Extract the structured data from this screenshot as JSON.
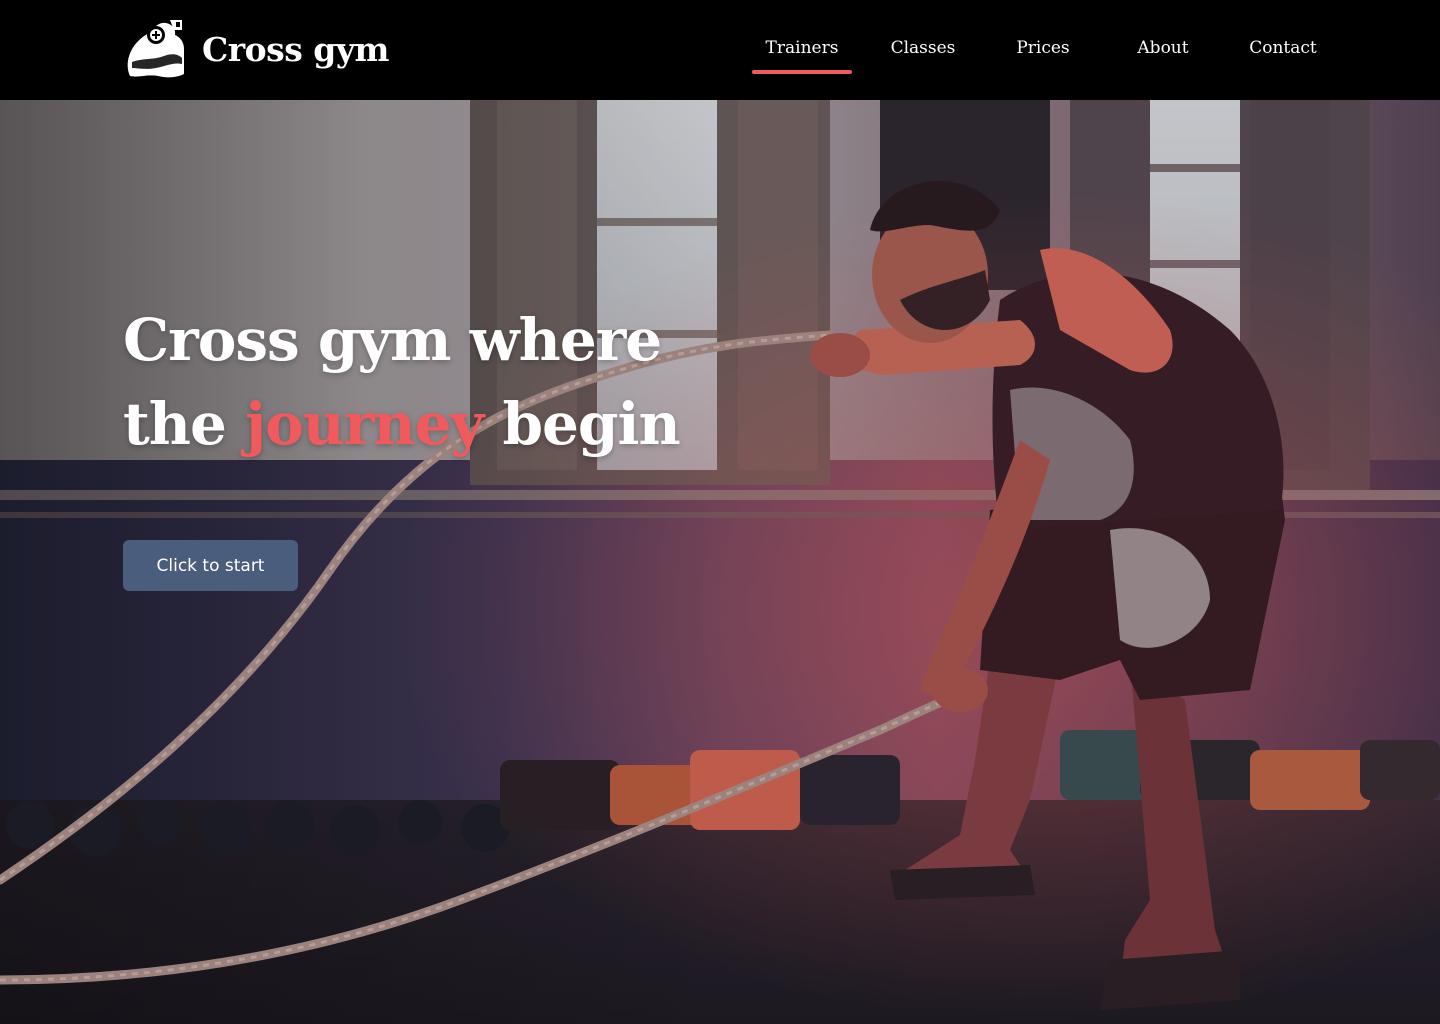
{
  "brand": {
    "name": "Cross gym",
    "logo_icon": "flexed-arm-icon"
  },
  "nav": {
    "items": [
      {
        "label": "Trainers",
        "active": true
      },
      {
        "label": "Classes",
        "active": false
      },
      {
        "label": "Prices",
        "active": false
      },
      {
        "label": "About",
        "active": false
      },
      {
        "label": "Contact",
        "active": false
      }
    ]
  },
  "hero": {
    "title_line1": "Cross gym where",
    "title_line2_prefix": "the",
    "title_line2_accent": "journey",
    "title_line2_suffix": "begin",
    "cta_label": "Click to start"
  },
  "colors": {
    "accent": "#f05a5c",
    "nav_background": "#000000",
    "cta_background": "#4a5d7c",
    "text": "#ffffff"
  }
}
